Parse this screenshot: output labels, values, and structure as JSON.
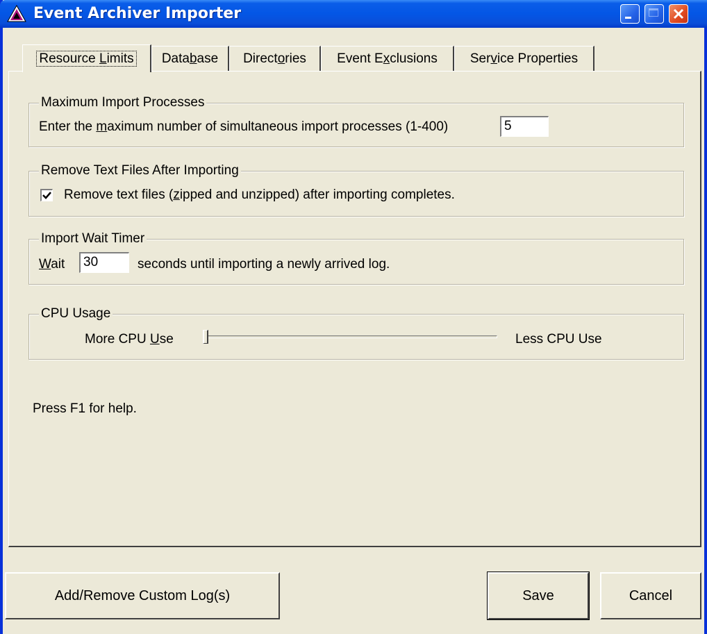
{
  "window": {
    "title": "Event Archiver Importer",
    "accent": "#0831d9",
    "close_color": "#e04a20"
  },
  "tabs": {
    "resource_limits": {
      "before": "Resource ",
      "accel": "L",
      "after": "imits"
    },
    "database": {
      "before": "Data",
      "accel": "b",
      "after": "ase"
    },
    "directories": {
      "before": "Direct",
      "accel": "o",
      "after": "ries"
    },
    "event_exclusions": {
      "before": "Event E",
      "accel": "x",
      "after": "clusions"
    },
    "service_properties": {
      "before": "Ser",
      "accel": "v",
      "after": "ice Properties"
    }
  },
  "groups": {
    "max_import": {
      "label": "Maximum Import Processes",
      "prompt_before": "Enter the ",
      "prompt_accel": "m",
      "prompt_after": "aximum number of simultaneous import processes (1-400)",
      "value": "5"
    },
    "remove_text": {
      "label": "Remove Text Files After Importing",
      "checked": true,
      "checkbox_before": "Remove text files (",
      "checkbox_accel": "z",
      "checkbox_after": "ipped and unzipped) after importing completes."
    },
    "wait_timer": {
      "label": "Import Wait Timer",
      "wait_accel": "W",
      "wait_after": "ait",
      "value": "30",
      "suffix": "seconds until importing a newly arrived log."
    },
    "cpu": {
      "label": "CPU Usage",
      "more_before": "More CPU ",
      "more_accel": "U",
      "more_after": "se",
      "less_label": "Less CPU Use",
      "slider_value": 0
    }
  },
  "help_text": "Press F1 for help.",
  "buttons": {
    "custom_logs": "Add/Remove Custom Log(s)",
    "save": "Save",
    "cancel": "Cancel"
  }
}
